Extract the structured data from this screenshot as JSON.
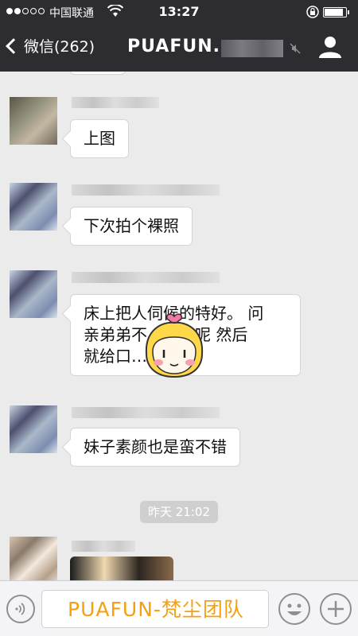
{
  "status_bar": {
    "carrier": "中国联通",
    "time": "13:27",
    "battery_level": 0.9
  },
  "nav": {
    "back_label": "微信(262)",
    "title": "PUAFUN."
  },
  "messages": [
    {
      "text": "上图"
    },
    {
      "text": "下次拍个裸照"
    },
    {
      "lines": [
        "床上把人伺候的特好。 问",
        "亲弟弟不…说行呢  然后",
        "就给口…"
      ]
    },
    {
      "text": "妹子素颜也是蛮不错"
    }
  ],
  "timestamp": "昨天 21:02",
  "input": {
    "watermark": "PUAFUN-梵尘团队"
  },
  "icons": {
    "wifi": "wifi-icon",
    "lock": "rotation-lock-icon",
    "battery": "battery-icon",
    "back": "chevron-left-icon",
    "mute": "mute-icon",
    "contact": "contact-icon",
    "voice": "voice-icon",
    "emoji": "emoji-icon",
    "plus": "plus-icon",
    "sticker": "cartoon-girl-sticker"
  },
  "colors": {
    "header_bg": "#2c2c31",
    "chat_bg": "#ebebeb",
    "watermark": "#f5a010"
  }
}
